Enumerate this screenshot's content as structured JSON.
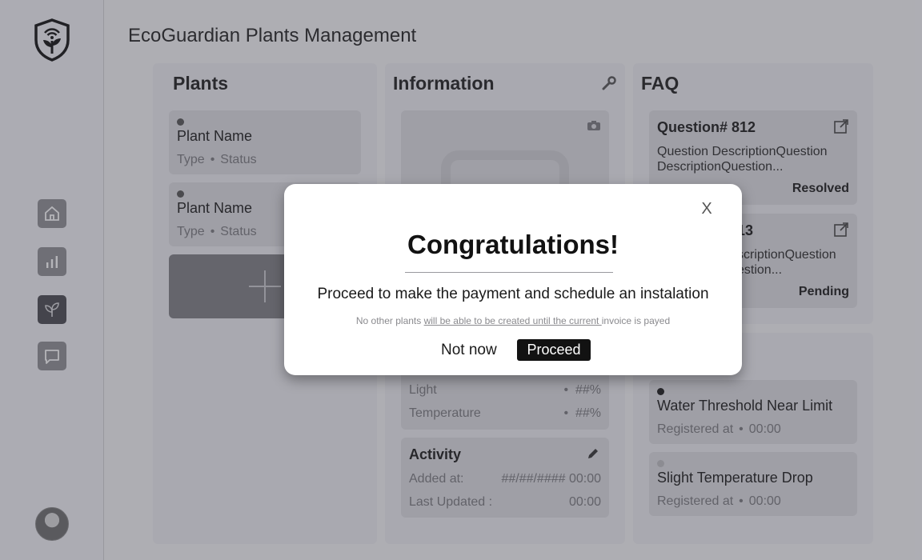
{
  "app": {
    "title": "EcoGuardian Plants Management"
  },
  "sidebar": {
    "logo_icon": "shield-sprout-wifi-icon",
    "items": [
      {
        "name": "home",
        "icon": "home-icon"
      },
      {
        "name": "analytics",
        "icon": "bar-chart-icon"
      },
      {
        "name": "plants",
        "icon": "sprout-icon",
        "active": true
      },
      {
        "name": "messages",
        "icon": "chat-icon"
      }
    ]
  },
  "plants": {
    "title": "Plants",
    "items": [
      {
        "name": "Plant Name",
        "type": "Type",
        "status": "Status"
      },
      {
        "name": "Plant Name",
        "type": "Type",
        "status": "Status"
      }
    ],
    "add_icon": "plus-icon"
  },
  "information": {
    "title": "Information",
    "tool_icon": "wrench-icon",
    "camera_icon": "camera-icon",
    "metrics": [
      {
        "label": "Light",
        "value": "##%"
      },
      {
        "label": "Temperature",
        "value": "##%"
      }
    ],
    "activity": {
      "title": "Activity",
      "edit_icon": "pencil-icon",
      "added_label": "Added at:",
      "added_value": "##/##/#### 00:00",
      "updated_label": "Last Updated :",
      "updated_value": "00:00"
    }
  },
  "faq": {
    "title": "FAQ",
    "items": [
      {
        "title": "Question# 812",
        "description": "Question DescriptionQuestion DescriptionQuestion...",
        "status": "Resolved"
      },
      {
        "title": "13",
        "description": "scriptionQuestion estion...",
        "status": "Pending"
      }
    ]
  },
  "notifications": {
    "title_fragment": "ns",
    "items": [
      {
        "title": "Water Threshold Near Limit",
        "registered_label": "Registered at",
        "time": "00:00",
        "dot_color": "#1a1a1a"
      },
      {
        "title": "Slight Temperature Drop",
        "registered_label": "Registered at",
        "time": "00:00",
        "dot_color": "#bdbdc1"
      }
    ]
  },
  "modal": {
    "close_label": "X",
    "title": "Congratulations!",
    "message": "Proceed to make the payment and schedule an instalation",
    "note_pre": "No other plants ",
    "note_underlined": "will be able to be created until the current ",
    "note_post": "invoice is payed",
    "secondary_label": "Not now",
    "primary_label": "Proceed"
  }
}
